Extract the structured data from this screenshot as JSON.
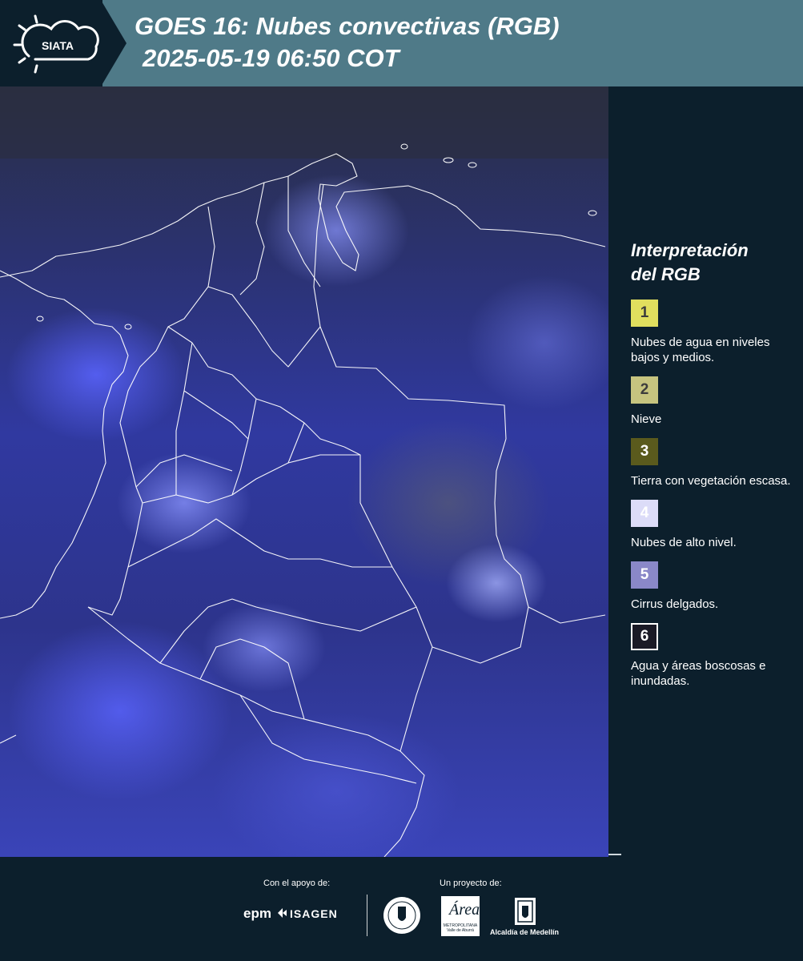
{
  "header": {
    "logo_text": "SIATA",
    "title": "GOES 16: Nubes convectivas (RGB)",
    "subtitle": "2025-05-19 06:50 COT"
  },
  "legend": {
    "title_line1": "Interpretación",
    "title_line2": "del RGB",
    "items": [
      {
        "number": "1",
        "label": "Nubes de agua en niveles bajos y medios.",
        "color": "#e1df5e"
      },
      {
        "number": "2",
        "label": "Nieve",
        "color": "#c6c47f"
      },
      {
        "number": "3",
        "label": "Tierra con vegetación escasa.",
        "color": "#5a5a1d"
      },
      {
        "number": "4",
        "label": "Nubes de alto nivel.",
        "color": "#dcdcf8"
      },
      {
        "number": "5",
        "label": "Cirrus delgados.",
        "color": "#8a88c8"
      },
      {
        "number": "6",
        "label": "Agua y áreas boscosas e inundadas.",
        "color": "#1a1a26"
      }
    ]
  },
  "footer": {
    "support_label": "Con el apoyo de:",
    "project_label": "Un proyecto de:",
    "epm": "epm",
    "isagen": "ISAGEN",
    "area_name": "Área",
    "area_sub": "METROPOLITANA Valle de Aburrá",
    "alcaldia": "Alcaldía de Medellín"
  }
}
